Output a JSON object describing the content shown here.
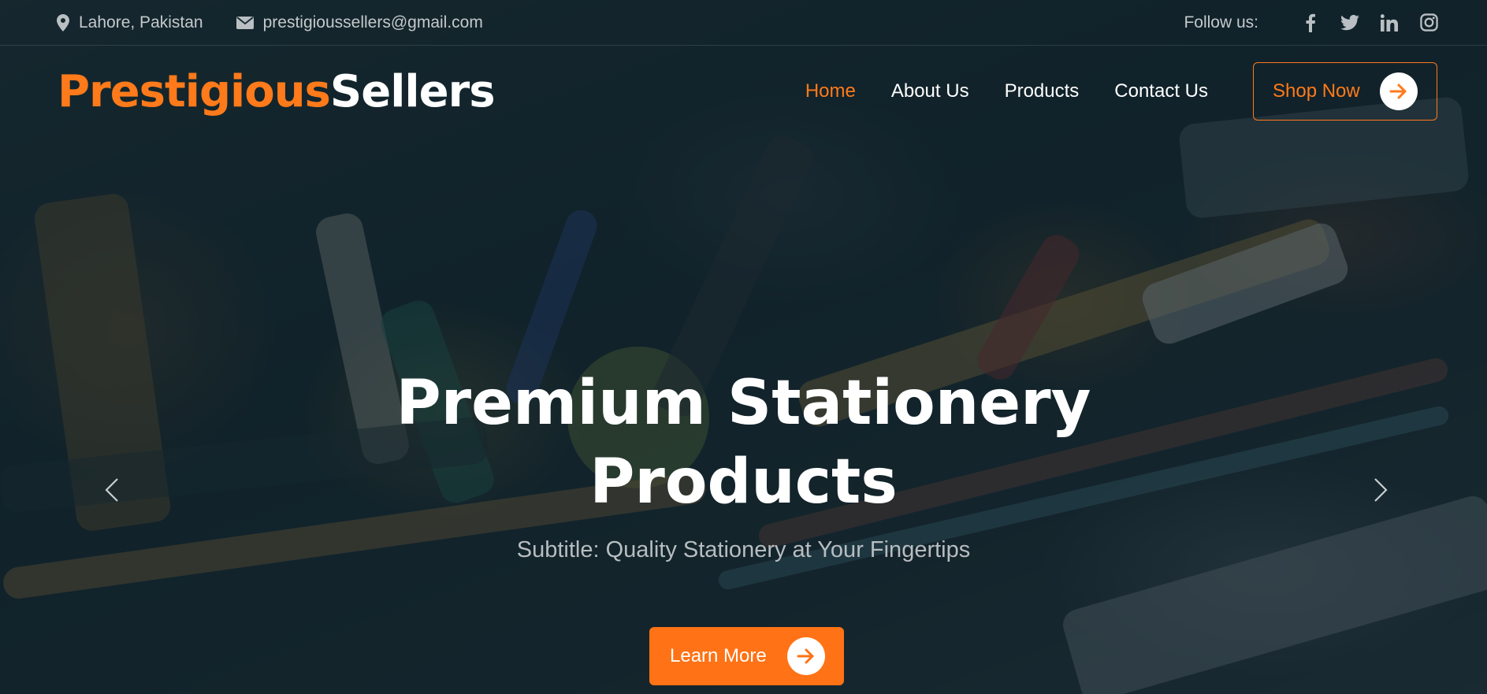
{
  "topbar": {
    "location": "Lahore, Pakistan",
    "email": "prestigioussellers@gmail.com",
    "follow_label": "Follow us:",
    "social_icons": [
      "facebook-icon",
      "twitter-icon",
      "linkedin-icon",
      "instagram-icon"
    ]
  },
  "brand": {
    "part1": "Prestigious",
    "part2": "Sellers"
  },
  "nav": {
    "items": [
      {
        "label": "Home",
        "active": true
      },
      {
        "label": "About Us",
        "active": false
      },
      {
        "label": "Products",
        "active": false
      },
      {
        "label": "Contact Us",
        "active": false
      }
    ],
    "shop_button": "Shop Now"
  },
  "hero": {
    "title_line1": "Premium Stationery",
    "title_line2": "Products",
    "subtitle": "Subtitle: Quality Stationery at Your Fingertips",
    "cta": "Learn More"
  },
  "colors": {
    "accent": "#ff7a1a",
    "overlay": "#0e2129",
    "text": "#ffffff"
  }
}
